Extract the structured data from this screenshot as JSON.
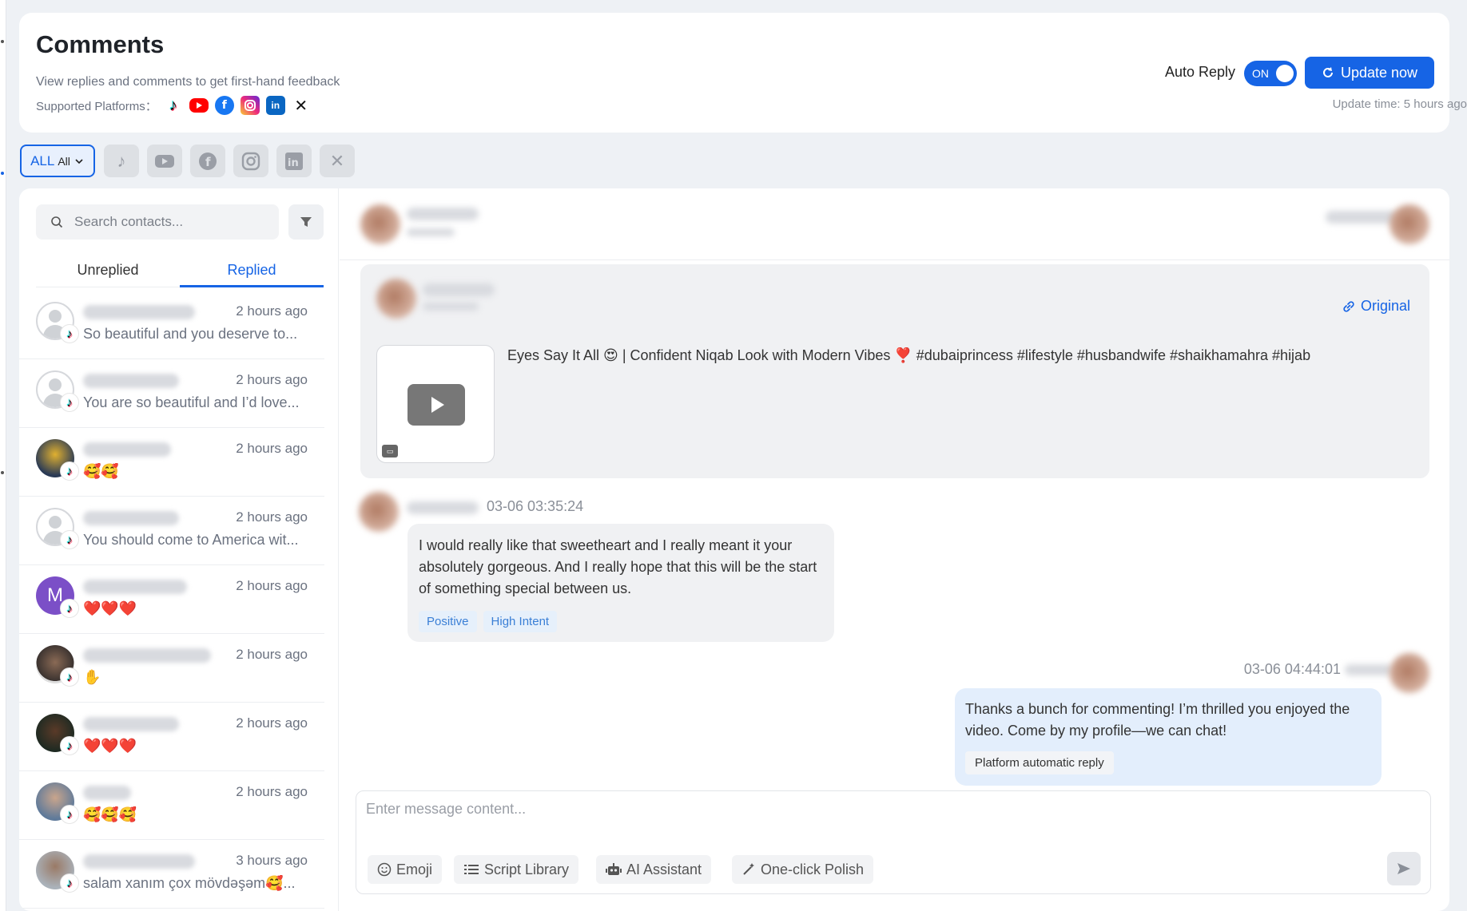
{
  "header": {
    "title": "Comments",
    "subtitle": "View replies and comments to get first-hand feedback",
    "platforms_label": "Supported Platforms：",
    "platforms": [
      "tiktok",
      "youtube",
      "facebook",
      "instagram",
      "linkedin",
      "x"
    ],
    "auto_reply_label": "Auto Reply",
    "auto_reply_state": "ON",
    "update_button": "Update now",
    "update_time": "Update time: 5 hours ago"
  },
  "filters": {
    "selected_main": "ALL",
    "selected_sub": "All",
    "platform_buttons": [
      "tiktok-icon",
      "youtube-icon",
      "facebook-icon",
      "instagram-icon",
      "linkedin-icon",
      "x-icon"
    ]
  },
  "sidebar": {
    "search_placeholder": "Search contacts...",
    "tabs": [
      "Unreplied",
      "Replied"
    ],
    "active_tab": "Replied",
    "contacts": [
      {
        "time": "2 hours ago",
        "message": "So beautiful and you deserve to..."
      },
      {
        "time": "2 hours ago",
        "message": "You are so beautiful and I’d love..."
      },
      {
        "time": "2 hours ago",
        "message": "🥰🥰"
      },
      {
        "time": "2 hours ago",
        "message": "You should come to America wit..."
      },
      {
        "time": "2 hours ago",
        "message": "❤️❤️❤️"
      },
      {
        "time": "2 hours ago",
        "message": "✋"
      },
      {
        "time": "2 hours ago",
        "message": "❤️❤️❤️"
      },
      {
        "time": "2 hours ago",
        "message": "🥰🥰🥰"
      },
      {
        "time": "3 hours ago",
        "message": "salam xanım çox mövdəşəm🥰..."
      }
    ]
  },
  "conversation": {
    "original_link": "Original",
    "post_title": "Eyes Say It All 😍 | Confident Niqab Look with Modern Vibes ❣️ #dubaiprincess #lifestyle #husbandwife #shaikhamahra #hijab",
    "comment": {
      "time": "03-06 03:35:24",
      "text": "I would really like that sweetheart and I really meant it your absolutely gorgeous. And I really hope that this will be the start of something special between us.",
      "tags": [
        "Positive",
        "High Intent"
      ]
    },
    "reply": {
      "time": "03-06 04:44:01",
      "text": "Thanks a bunch for commenting! I’m thrilled you enjoyed the video. Come by my profile—we can chat!",
      "tag": "Platform automatic reply"
    },
    "composer": {
      "placeholder": "Enter message content...",
      "tools": [
        "Emoji",
        "Script Library",
        "AI Assistant",
        "One-click Polish"
      ]
    }
  },
  "colors": {
    "accent": "#1664e5",
    "tag_bg": "#e6f0fb",
    "reply_bubble": "#e3eefc"
  }
}
